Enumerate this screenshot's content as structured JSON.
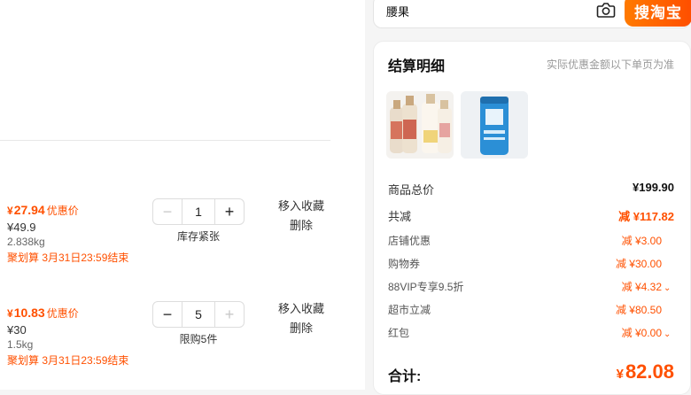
{
  "items": [
    {
      "price_now": "27.94",
      "price_tag": "优惠价",
      "price_orig": "¥49.9",
      "weight": "2.838kg",
      "promo": "聚划算 3月31日23:59结束",
      "qty": "1",
      "stock": "库存紧张",
      "minus_disabled": true,
      "plus_disabled": false,
      "action_fav": "移入收藏",
      "action_del": "删除"
    },
    {
      "price_now": "10.83",
      "price_tag": "优惠价",
      "price_orig": "¥30",
      "weight": "1.5kg",
      "promo": "聚划算 3月31日23:59结束",
      "qty": "5",
      "stock": "限购5件",
      "minus_disabled": false,
      "plus_disabled": true,
      "action_fav": "移入收藏",
      "action_del": "删除"
    }
  ],
  "search": {
    "text": "腰果",
    "button": "搜淘宝"
  },
  "summary": {
    "title": "结算明细",
    "note": "实际优惠金额以下单页为准",
    "subtotal_label": "商品总价",
    "subtotal": "¥199.90",
    "discount_label": "共减",
    "discount": "减 ¥117.82",
    "lines": [
      {
        "label": "店铺优惠",
        "value": "减 ¥3.00",
        "chevron": false
      },
      {
        "label": "购物券",
        "value": "减 ¥30.00",
        "chevron": false
      },
      {
        "label": "88VIP专享9.5折",
        "value": "减 ¥4.32",
        "chevron": true
      },
      {
        "label": "超市立减",
        "value": "减 ¥80.50",
        "chevron": false
      },
      {
        "label": "红包",
        "value": "减 ¥0.00",
        "chevron": true
      }
    ],
    "total_label": "合计:",
    "total": "82.08"
  },
  "colors": {
    "accent": "#ff5000"
  }
}
